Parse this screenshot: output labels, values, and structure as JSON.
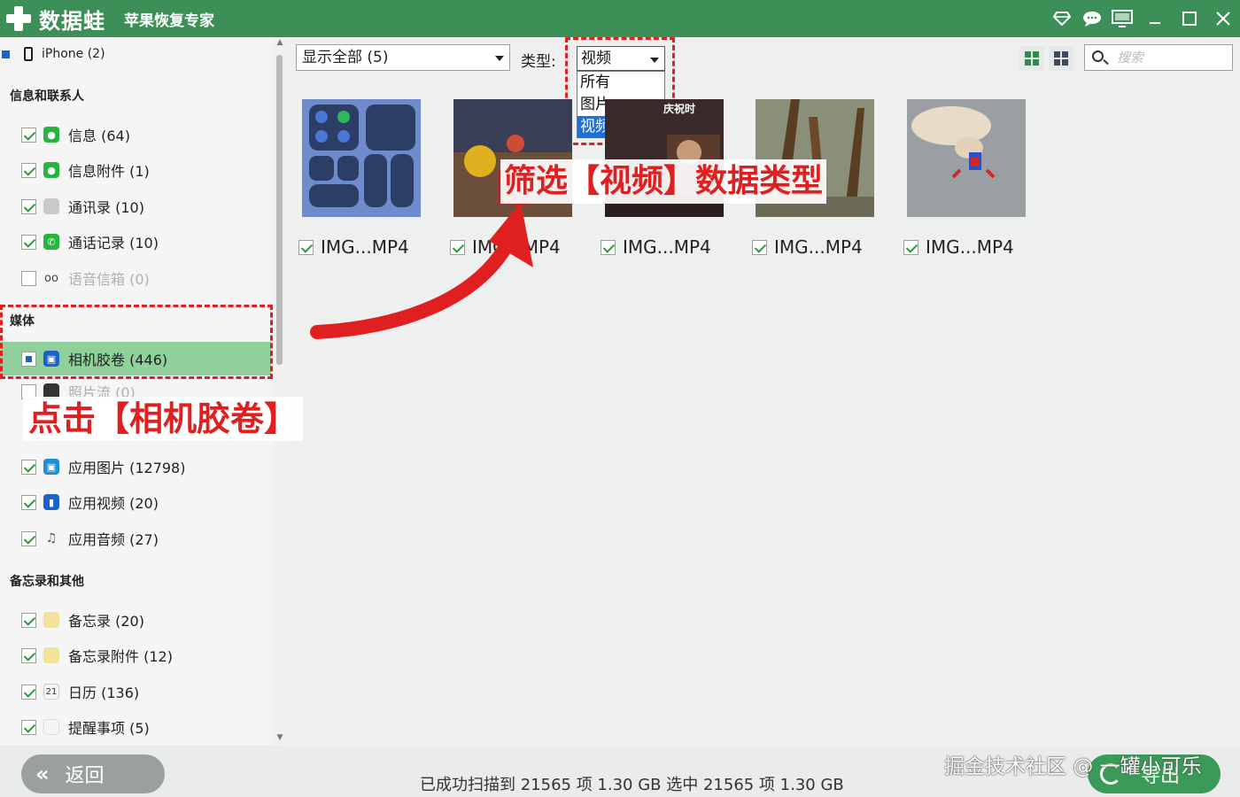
{
  "app": {
    "brand": "数据蛙",
    "product": "苹果恢复专家"
  },
  "window_icons": [
    "diamond-icon",
    "chat-icon",
    "monitor-icon",
    "minimize-icon",
    "maximize-icon",
    "close-icon"
  ],
  "sidebar": {
    "device": "iPhone (2)",
    "sections": [
      {
        "title": "信息和联系人"
      },
      {
        "title": "媒体"
      },
      {
        "title": "备忘录和其他"
      }
    ],
    "items": [
      {
        "label": "信息 (64)",
        "icon": "message-icon",
        "checked": true
      },
      {
        "label": "信息附件 (1)",
        "icon": "attachment-icon",
        "checked": true
      },
      {
        "label": "通讯录 (10)",
        "icon": "contacts-icon",
        "checked": true
      },
      {
        "label": "通话记录 (10)",
        "icon": "phone-icon",
        "checked": true
      },
      {
        "label": "语音信箱 (0)",
        "icon": "voicemail-icon",
        "checked": false
      },
      {
        "label": "相机胶卷 (446)",
        "icon": "camera-roll-icon",
        "checked": "partial",
        "selected": true
      },
      {
        "label": "照片流 (0)",
        "icon": "photo-stream-icon",
        "checked": false
      },
      {
        "label": "应用图片 (12798)",
        "icon": "app-photos-icon",
        "checked": true
      },
      {
        "label": "应用视频 (20)",
        "icon": "app-video-icon",
        "checked": true
      },
      {
        "label": "应用音频 (27)",
        "icon": "app-audio-icon",
        "checked": true
      },
      {
        "label": "备忘录 (20)",
        "icon": "notes-icon",
        "checked": true
      },
      {
        "label": "备忘录附件 (12)",
        "icon": "notes-attachment-icon",
        "checked": true
      },
      {
        "label": "日历 (136)",
        "icon": "calendar-icon",
        "checked": true
      },
      {
        "label": "提醒事项 (5)",
        "icon": "reminders-icon",
        "checked": true
      }
    ]
  },
  "toolbar": {
    "filter_value": "显示全部 (5)",
    "type_label": "类型:",
    "type_value": "视频",
    "type_options": [
      "所有",
      "图片",
      "视频"
    ],
    "search_placeholder": "搜索"
  },
  "thumbnails": [
    {
      "name": "IMG...MP4",
      "checked": true
    },
    {
      "name": "IMG...MP4",
      "checked": true
    },
    {
      "name": "IMG...MP4",
      "checked": true
    },
    {
      "name": "IMG...MP4",
      "checked": true
    },
    {
      "name": "IMG...MP4",
      "checked": true
    }
  ],
  "thumbnail_overlay_text": "庆祝时",
  "annotations": {
    "filter_hint": "筛选【视频】数据类型",
    "click_hint": "点击【相机胶卷】",
    "color": "#e02020"
  },
  "footer": {
    "back_label": "返回",
    "status": "已成功扫描到 21565 项 1.30 GB   选中 21565 项 1.30 GB",
    "export_label": "导出",
    "watermark": "掘金技术社区 @ 一罐小可乐"
  },
  "colors": {
    "titlebar": "#3d8f58",
    "selected_row": "#8fd09b",
    "dropdown_active": "#1e6fd6",
    "export_button": "#3a9a58"
  }
}
